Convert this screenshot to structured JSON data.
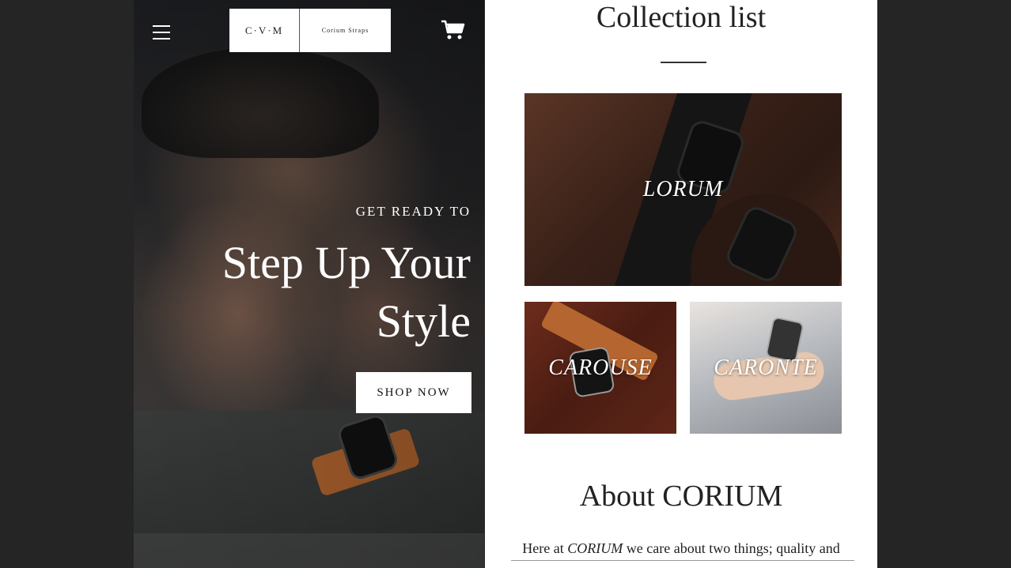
{
  "header": {
    "logo_mark": "C·V·M",
    "logo_name": "Corium Straps"
  },
  "hero": {
    "eyebrow": "GET READY TO",
    "title": "Step Up Your Style",
    "cta_label": "SHOP NOW"
  },
  "collections": {
    "title": "Collection list",
    "items": [
      {
        "label": "LORUM"
      },
      {
        "label": "CAROUSE"
      },
      {
        "label": "CARONTE"
      }
    ]
  },
  "about": {
    "title": "About CORIUM",
    "text_prefix": "Here at ",
    "text_brand": "CORIUM",
    "text_suffix": " we care about two things; quality and"
  },
  "colors": {
    "background": "#252525",
    "hero_text": "#ffffff",
    "button_bg": "#ffffff",
    "heading_text": "#222222"
  },
  "icons": {
    "menu": "hamburger-icon",
    "cart": "cart-icon"
  }
}
